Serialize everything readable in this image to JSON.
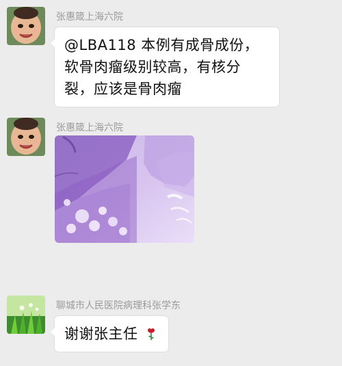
{
  "messages": [
    {
      "sender": "张惠箴上海六院",
      "text_lines": [
        "@LBA118 本例有成骨成份，",
        "软骨肉瘤级别较高，有核分",
        "裂，应该是骨肉瘤"
      ]
    },
    {
      "sender": "张惠箴上海六院",
      "image_alt": "histology-slide"
    },
    {
      "sender": "聊城市人民医院病理科张学东",
      "text": "谢谢张主任",
      "emoji": "rose"
    }
  ]
}
